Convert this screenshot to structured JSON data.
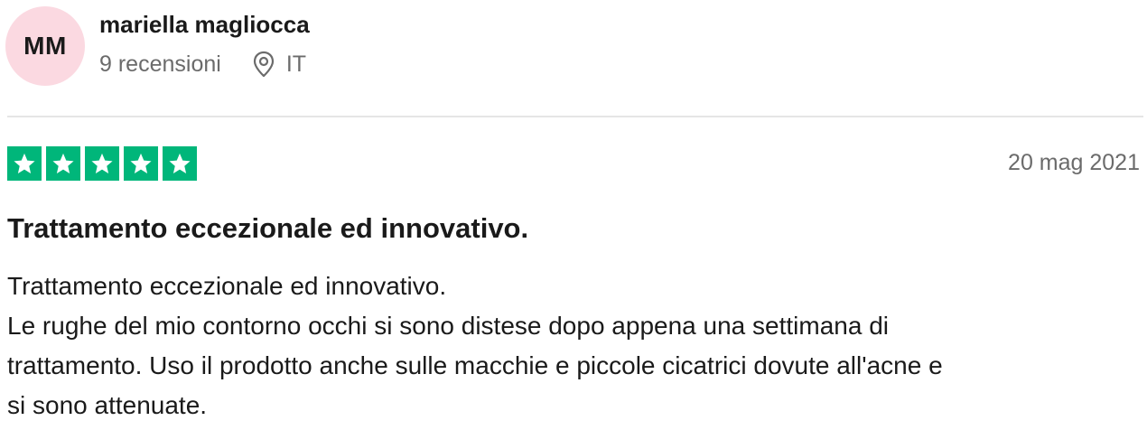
{
  "reviewer": {
    "initials": "MM",
    "name": "mariella magliocca",
    "reviews_count": "9 recensioni",
    "location_icon": "location-pin-icon",
    "country": "IT"
  },
  "review": {
    "rating": 5,
    "max_rating": 5,
    "star_color": "#00b67a",
    "date": "20 mag 2021",
    "title": "Trattamento eccezionale ed innovativo.",
    "body_lines": [
      "Trattamento eccezionale ed innovativo.",
      "Le rughe del mio contorno occhi si sono distese dopo appena una settimana di",
      "trattamento. Uso il prodotto anche sulle macchie e piccole cicatrici dovute all'acne e",
      "si sono attenuate."
    ]
  },
  "colors": {
    "avatar_bg": "#fbd9e1",
    "muted_text": "#6b6b6b",
    "divider": "#e5e5e5"
  }
}
